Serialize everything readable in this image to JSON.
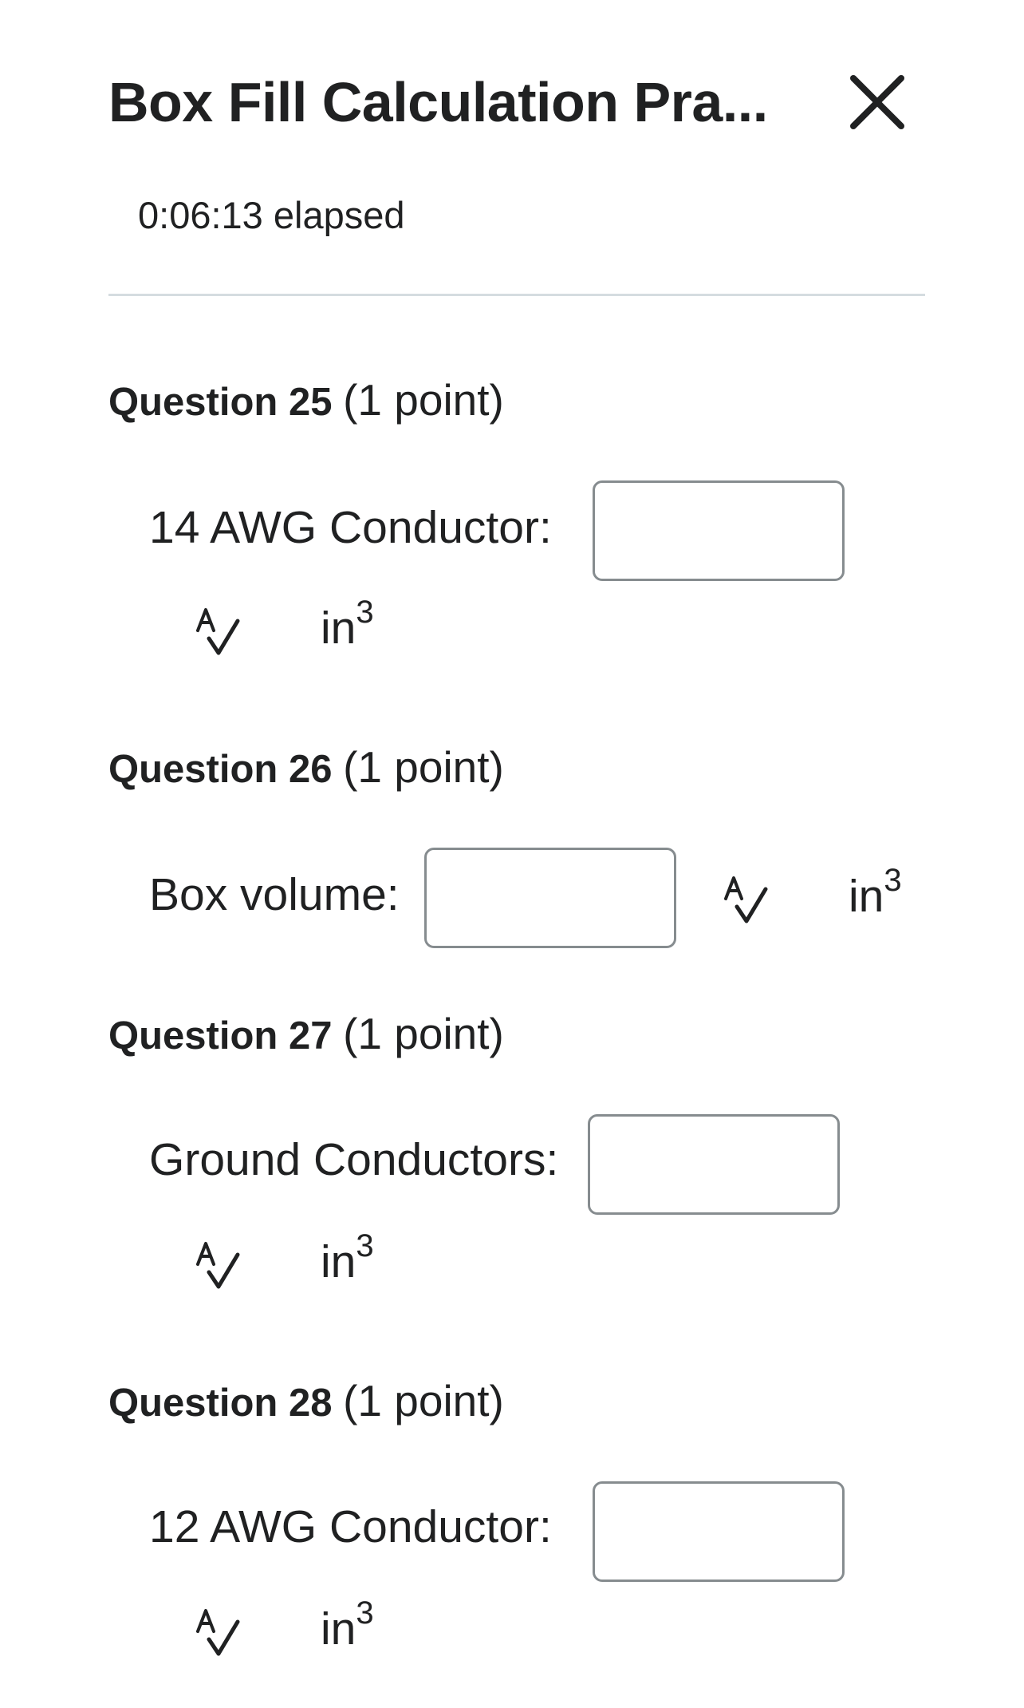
{
  "header": {
    "title": "Box Fill Calculation Pra...",
    "close_icon": "close-icon"
  },
  "timer": {
    "text": "0:06:13 elapsed"
  },
  "questions": [
    {
      "number": "Question 25",
      "points": "(1 point)",
      "label": "14 AWG Conductor:",
      "value": "",
      "unit_base": "in",
      "unit_exp": "3"
    },
    {
      "number": "Question 26",
      "points": "(1 point)",
      "label": "Box volume:",
      "value": "",
      "unit_base": "in",
      "unit_exp": "3"
    },
    {
      "number": "Question 27",
      "points": "(1 point)",
      "label": "Ground Conductors:",
      "value": "",
      "unit_base": "in",
      "unit_exp": "3"
    },
    {
      "number": "Question 28",
      "points": "(1 point)",
      "label": "12 AWG Conductor:",
      "value": "",
      "unit_base": "in",
      "unit_exp": "3"
    }
  ],
  "icons": {
    "spellcheck": "spellcheck-icon"
  }
}
